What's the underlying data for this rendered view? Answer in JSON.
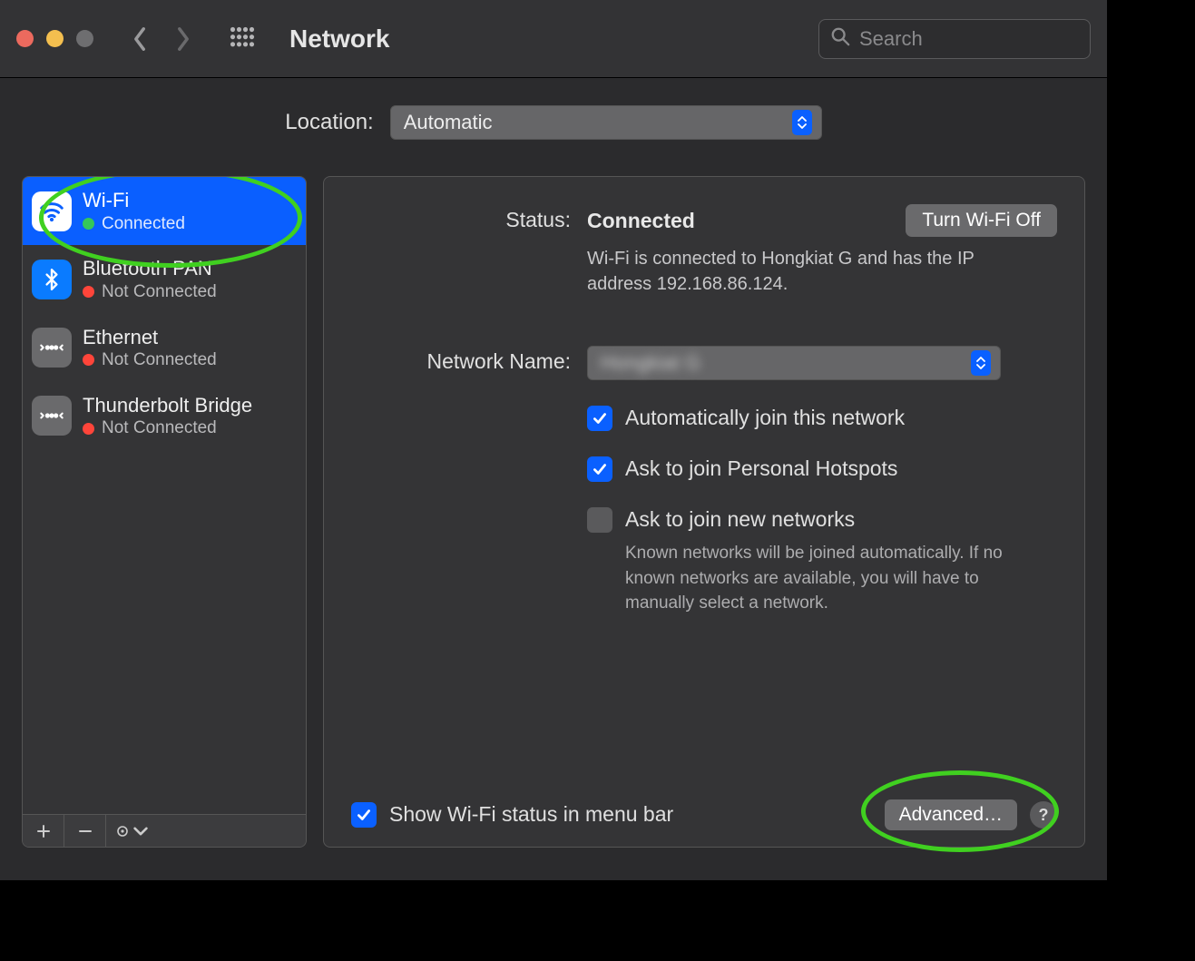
{
  "toolbar": {
    "title": "Network",
    "search_placeholder": "Search"
  },
  "location": {
    "label": "Location:",
    "value": "Automatic"
  },
  "sidebar": {
    "items": [
      {
        "name": "Wi-Fi",
        "status": "Connected",
        "status_color": "green",
        "icon": "wifi",
        "selected": true
      },
      {
        "name": "Bluetooth PAN",
        "status": "Not Connected",
        "status_color": "red",
        "icon": "bluetooth"
      },
      {
        "name": "Ethernet",
        "status": "Not Connected",
        "status_color": "red",
        "icon": "ethernet"
      },
      {
        "name": "Thunderbolt Bridge",
        "status": "Not Connected",
        "status_color": "red",
        "icon": "thunderbolt"
      }
    ]
  },
  "detail": {
    "status_label": "Status:",
    "status_value": "Connected",
    "toggle_button": "Turn Wi-Fi Off",
    "status_desc": "Wi-Fi is connected to Hongkiat G and has the IP address 192.168.86.124.",
    "network_name_label": "Network Name:",
    "network_name_value": "Hongkiat G",
    "auto_join": "Automatically join this network",
    "ask_hotspot": "Ask to join Personal Hotspots",
    "ask_new": "Ask to join new networks",
    "ask_new_hint": "Known networks will be joined automatically. If no known networks are available, you will have to manually select a network.",
    "show_status": "Show Wi-Fi status in menu bar",
    "advanced": "Advanced…"
  }
}
